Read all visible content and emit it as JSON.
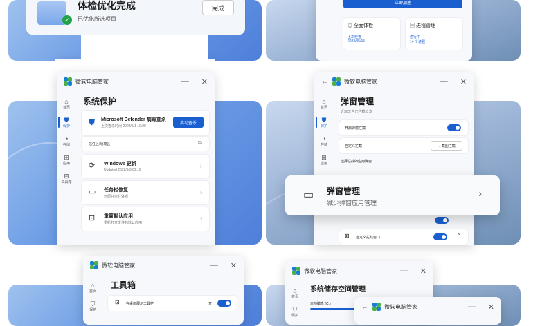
{
  "tile1": {
    "title": "体检优化完成",
    "subtitle": "已优化所选项目",
    "button": "完成"
  },
  "tile2": {
    "speed_button": "立即加速",
    "card1_title": "全面体检",
    "card1_sub1": "上次检查",
    "card1_sub2": "2023/05/15",
    "card2_title": "进程管理",
    "card2_sub1": "进行中",
    "card2_sub2": "14 个进程"
  },
  "app_name": "微软电脑管家",
  "sidebar": {
    "home": "首页",
    "protect": "保护",
    "storage": "存储",
    "apps": "应用",
    "toolbox": "工具箱"
  },
  "tile3": {
    "heading": "系统保护",
    "defender_title": "Microsoft Defender 病毒查杀",
    "defender_sub": "上次查杀时间 2023/5/1 10:00",
    "defender_btn": "启动查杀",
    "trust_label": "信任区/隔离区",
    "update_title": "Windows 更新",
    "update_sub": "Updated 2022/9/6 09:19",
    "taskbar_title": "任务栏修复",
    "taskbar_sub": "还原任务栏外观",
    "default_title": "重置默认应用",
    "default_sub": "重新打开文件的默认应用"
  },
  "tile4": {
    "heading": "弹窗管理",
    "sub": "近30天内已拦截 0 次",
    "row1": "开启弹窗拦截",
    "row2": "自定义拦截",
    "row2_btn": "截图拦截",
    "row3": "选择拦截的应用弹窗",
    "popup_title": "弹窗管理",
    "popup_sub": "减少弹窗应用管理",
    "row4": "自定义拦截窗口"
  },
  "tile5": {
    "heading": "工具箱",
    "row1": "在桌面展示工具栏",
    "row1_state": "开"
  },
  "tile6": {
    "heading": "系统储存空间管理",
    "row1": "本地磁盘 (C:)"
  },
  "colors": {
    "accent": "#1a5fd0",
    "bg_left": "#6d9de6",
    "bg_right": "#9cb4d6"
  }
}
